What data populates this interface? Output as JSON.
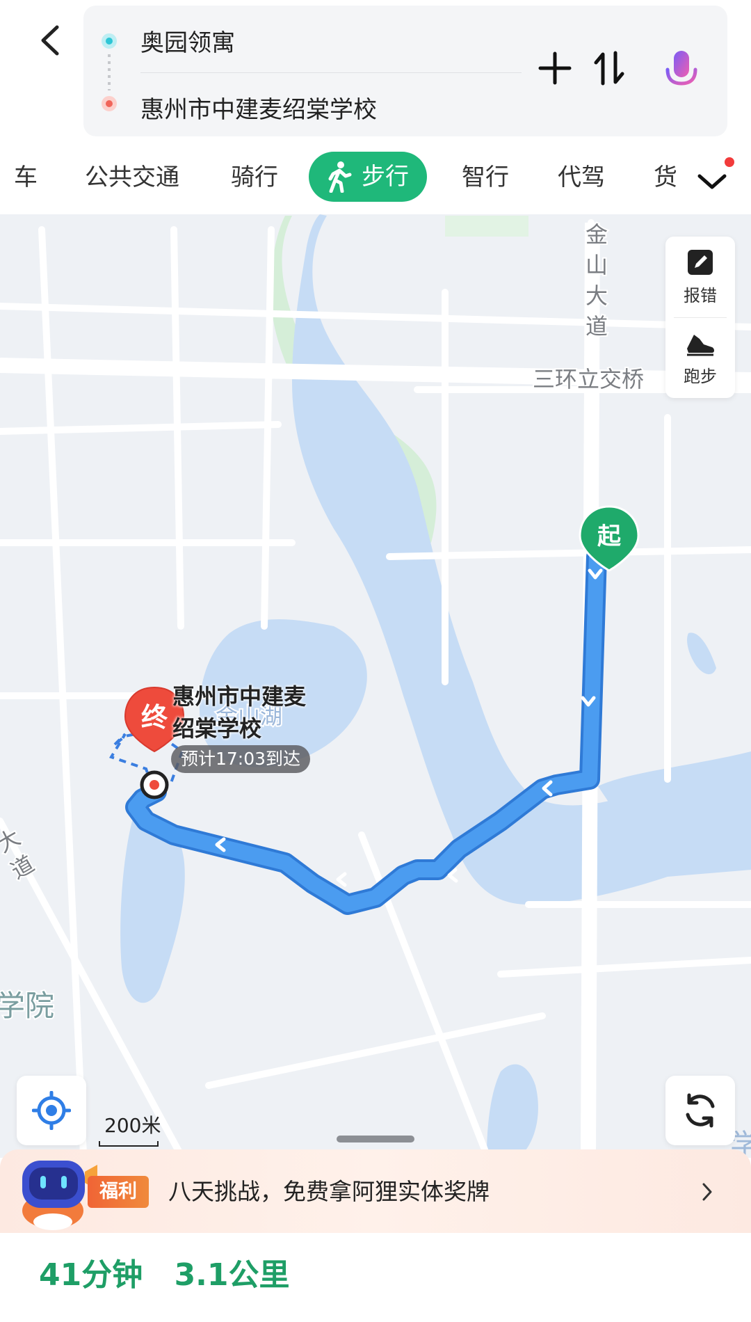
{
  "route": {
    "from": "奥园领寓",
    "to": "惠州市中建麦绍棠学校"
  },
  "tools": {
    "add": "add-waypoint",
    "swap": "swap-route",
    "voice": "voice-input"
  },
  "tabs": [
    {
      "label": "车"
    },
    {
      "label": "公共交通"
    },
    {
      "label": "骑行"
    },
    {
      "label": "步行",
      "active": true
    },
    {
      "label": "智行"
    },
    {
      "label": "代驾"
    },
    {
      "label": "货"
    }
  ],
  "map": {
    "road_labels": [
      "金",
      "山",
      "大",
      "道",
      "三环立交桥",
      "金山湖",
      "大",
      "道",
      "学院",
      "学",
      "院"
    ],
    "start_marker": "起",
    "end_marker": "终",
    "destination_label_line1": "惠州市中建麦",
    "destination_label_line2": "绍棠学校",
    "eta": "预计17:03到达",
    "scale": "200米"
  },
  "side_panel": {
    "report": "报错",
    "run": "跑步"
  },
  "promo": {
    "badge": "福利",
    "text": "八天挑战，免费拿阿狸实体奖牌"
  },
  "summary": {
    "duration": "41分钟",
    "distance": "3.1公里"
  },
  "colors": {
    "accent_green": "#1fb87a",
    "route_blue": "#3a8ee6",
    "water": "#c6dcf5",
    "park": "#d9f0dc",
    "end_red": "#ee4b3c",
    "summary_green": "#1e9e66"
  }
}
